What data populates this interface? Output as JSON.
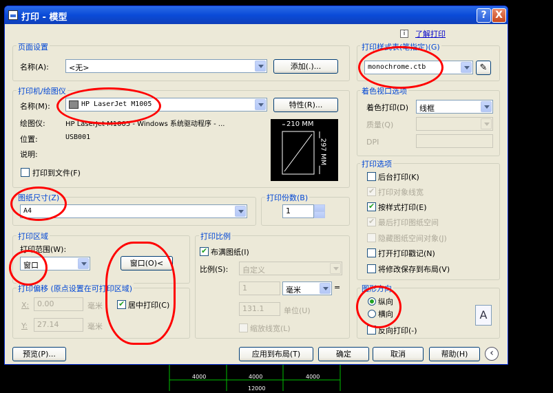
{
  "window": {
    "title": "打印 - 模型",
    "help_btn": "?",
    "close_btn": "X"
  },
  "learn_link": "了解打印",
  "page_setup": {
    "group": "页面设置",
    "name_label": "名称(A):",
    "name_value": "<无>",
    "add_button": "添加(.)..."
  },
  "printer": {
    "group": "打印机/绘图仪",
    "name_label": "名称(M):",
    "name_value": "HP LaserJet M1005",
    "properties_button": "特性(R)...",
    "plotter_label": "绘图仪:",
    "plotter_value": "HP LaserJet M1005 - Windows 系统驱动程序 - ...",
    "location_label": "位置:",
    "location_value": "USB001",
    "desc_label": "说明:",
    "print_to_file": "打印到文件(F)",
    "preview_width": "210 MM",
    "preview_height": "297 MM"
  },
  "paper": {
    "group": "图纸尺寸(Z)",
    "value": "A4"
  },
  "copies": {
    "group": "打印份数(B)",
    "value": "1"
  },
  "area": {
    "group": "打印区域",
    "range_label": "打印范围(W):",
    "range_value": "窗口",
    "window_button": "窗口(O)<"
  },
  "offset": {
    "group": "打印偏移 (原点设置在可打印区域)",
    "x_label": "X:",
    "x_value": "0.00",
    "y_label": "Y:",
    "y_value": "27.14",
    "unit": "毫米",
    "center": "居中打印(C)"
  },
  "scale": {
    "group": "打印比例",
    "fit": "布满图纸(I)",
    "ratio_label": "比例(S):",
    "ratio_value": "自定义",
    "v1": "1",
    "unit_value": "毫米",
    "eq": "=",
    "v2": "131.1",
    "unit_label": "单位(U)",
    "lineweight": "缩放线宽(L)"
  },
  "style_table": {
    "group": "打印样式表(笔指定)(G)",
    "value": "monochrome.ctb"
  },
  "shaded": {
    "group": "着色视口选项",
    "shade_label": "着色打印(D)",
    "shade_value": "线框",
    "quality_label": "质量(Q)",
    "dpi_label": "DPI"
  },
  "options": {
    "group": "打印选项",
    "items": [
      "后台打印(K)",
      "打印对象线宽",
      "按样式打印(E)",
      "最后打印图纸空间",
      "隐藏图纸空间对象(J)",
      "打开打印戳记(N)",
      "将修改保存到布局(V)"
    ]
  },
  "orientation": {
    "group": "图形方向",
    "portrait": "纵向",
    "landscape": "横向",
    "upside_down": "反向打印(-)",
    "paper_icon": "A"
  },
  "footer": {
    "preview": "预览(P)...",
    "apply": "应用到布局(T)",
    "ok": "确定",
    "cancel": "取消",
    "help": "帮助(H)"
  },
  "cad": {
    "dims": [
      "4000",
      "4000",
      "4000",
      "12000"
    ]
  }
}
